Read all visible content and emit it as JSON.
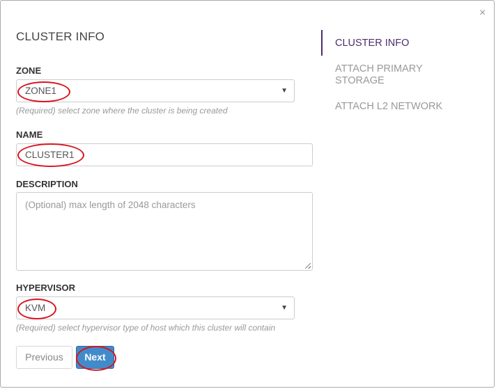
{
  "dialog": {
    "close_glyph": "×",
    "section_title": "CLUSTER INFO"
  },
  "form": {
    "zone": {
      "label": "ZONE",
      "value": "ZONE1",
      "help": "(Required) select zone where the cluster is being created"
    },
    "name": {
      "label": "NAME",
      "value": "CLUSTER1"
    },
    "description": {
      "label": "DESCRIPTION",
      "placeholder": "(Optional) max length of 2048 characters"
    },
    "hypervisor": {
      "label": "HYPERVISOR",
      "value": "KVM",
      "help": "(Required) select hypervisor type of host which this cluster will contain"
    },
    "dropdown_arrow": "▼"
  },
  "buttons": {
    "previous_label": "Previous",
    "next_label": "Next"
  },
  "steps": {
    "items": [
      {
        "label": "CLUSTER INFO",
        "active": true
      },
      {
        "label": "ATTACH PRIMARY STORAGE",
        "active": false
      },
      {
        "label": "ATTACH L2 NETWORK",
        "active": false
      }
    ]
  },
  "colors": {
    "accent": "#4d2d6b",
    "primary_button": "#428bca",
    "annotation": "#d9141e"
  }
}
